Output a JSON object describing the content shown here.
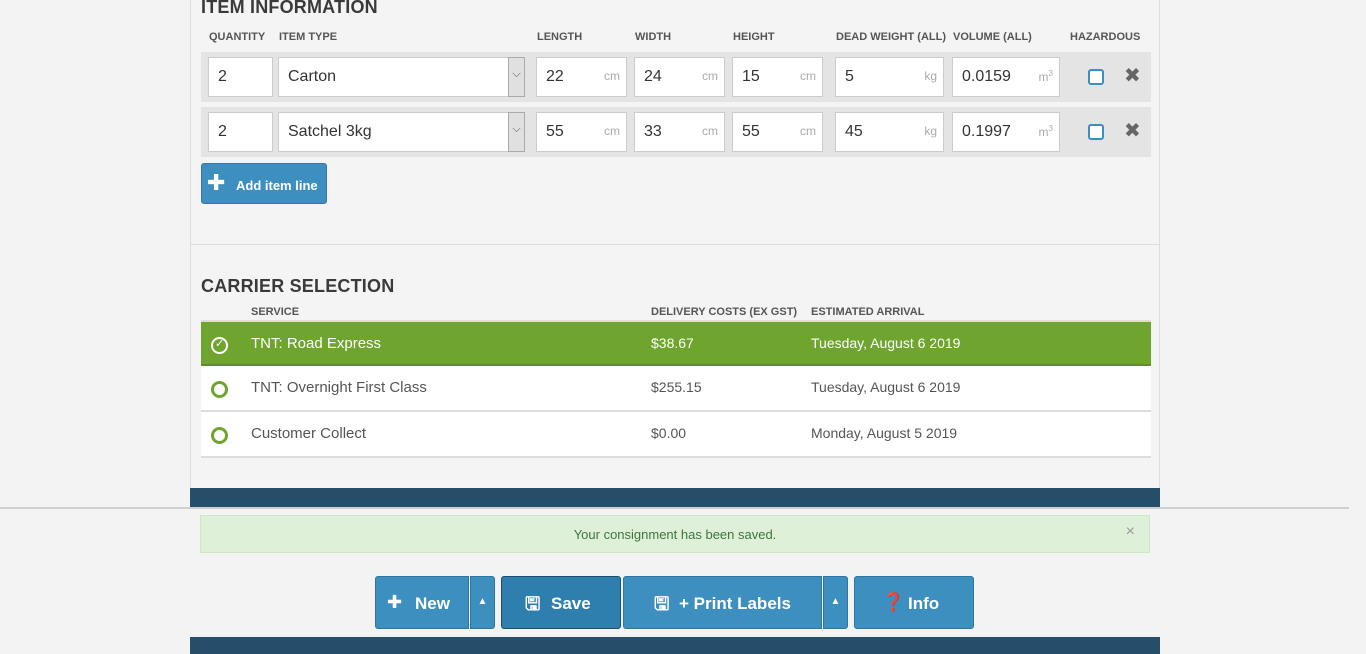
{
  "item_section": {
    "title": "ITEM INFORMATION",
    "columns": [
      "QUANTITY",
      "ITEM TYPE",
      "LENGTH",
      "WIDTH",
      "HEIGHT",
      "DEAD WEIGHT (ALL)",
      "VOLUME (ALL)",
      "HAZARDOUS"
    ],
    "rows": [
      {
        "quantity": "2",
        "item_type": "Carton",
        "length": "22",
        "width": "24",
        "height": "15",
        "weight": "5",
        "volume": "0.0159"
      },
      {
        "quantity": "2",
        "item_type": "Satchel 3kg",
        "length": "55",
        "width": "33",
        "height": "55",
        "weight": "45",
        "volume": "0.1997"
      }
    ],
    "units": {
      "cm": "cm",
      "kg": "kg",
      "m": "m",
      "m_sup": "3"
    },
    "add_label": "Add item line"
  },
  "carrier_section": {
    "title": "CARRIER SELECTION",
    "columns": [
      "SERVICE",
      "DELIVERY COSTS (EX GST)",
      "ESTIMATED ARRIVAL"
    ],
    "rows": [
      {
        "service": "TNT: Road Express",
        "cost": "$38.67",
        "eta": "Tuesday, August 6 2019",
        "selected": true
      },
      {
        "service": "TNT: Overnight First Class",
        "cost": "$255.15",
        "eta": "Tuesday, August 6 2019",
        "selected": false
      },
      {
        "service": "Customer Collect",
        "cost": "$0.00",
        "eta": "Monday, August 5 2019",
        "selected": false
      }
    ]
  },
  "alert": {
    "message": "Your consignment has been saved.",
    "close": "×"
  },
  "toolbar": {
    "new_label": "New",
    "save_label": "Save",
    "print_label": "+ Print Labels",
    "info_label": "Info"
  },
  "colors": {
    "primary": "#3d8fbf",
    "selected": "#6fa52e",
    "band": "#244e6a"
  }
}
